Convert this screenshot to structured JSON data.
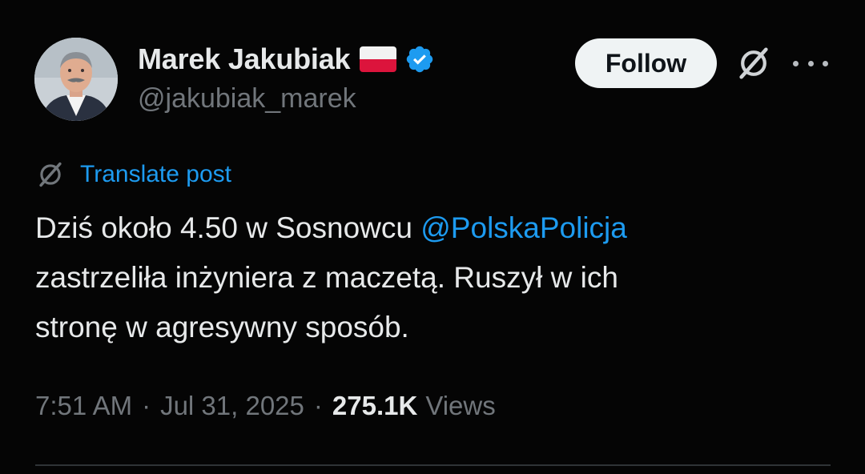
{
  "author": {
    "display_name": "Marek Jakubiak",
    "handle": "@jakubiak_marek",
    "flag_icon": "poland-flag-icon",
    "verified_icon": "verified-badge-icon",
    "verified_color": "#1d9bf0"
  },
  "actions": {
    "follow_label": "Follow",
    "grok_icon": "grok-icon",
    "more_icon": "more-icon"
  },
  "translate": {
    "label": "Translate post",
    "icon": "grok-icon"
  },
  "post": {
    "line1_text": "Dziś około 4.50 w Sosnowcu ",
    "mention": "@PolskaPolicja",
    "line2": "zastrzeliła inżyniera z maczetą. Ruszył w ich",
    "line3": "stronę w agresywny sposób."
  },
  "meta": {
    "time": "7:51 AM",
    "separator": "·",
    "date": "Jul 31, 2025",
    "views_count": "275.1K",
    "views_label": "Views"
  },
  "colors": {
    "background": "#050505",
    "text": "#e7e9ea",
    "secondary": "#71767b",
    "link": "#1d9bf0",
    "button_bg": "#eff3f4"
  }
}
